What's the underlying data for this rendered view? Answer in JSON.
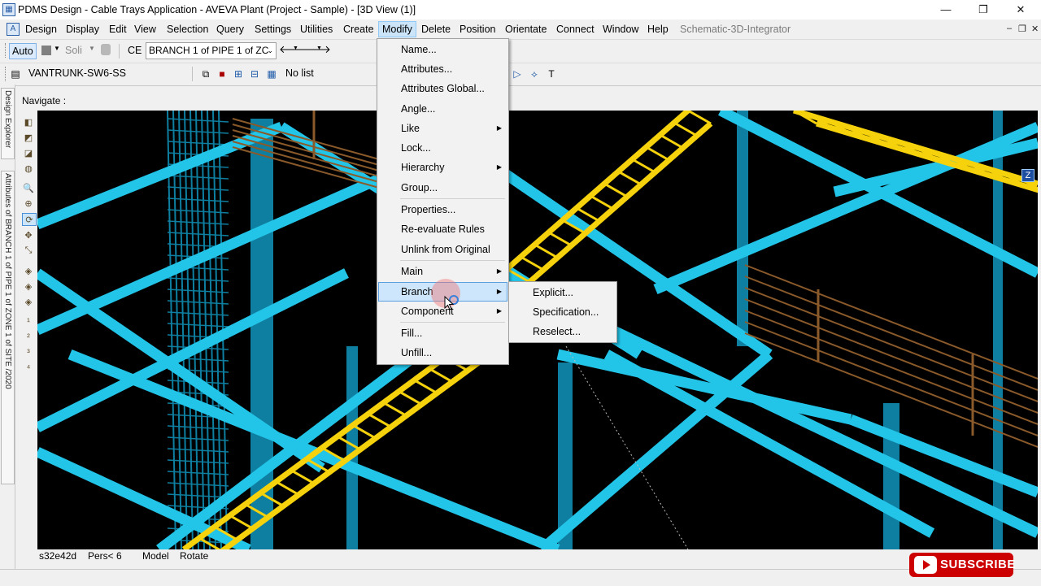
{
  "window": {
    "title": "PDMS Design - Cable Trays Application -  AVEVA Plant (Project - Sample) - [3D View (1)]",
    "controls": {
      "minimize": "—",
      "maximize": "❐",
      "close": "✕"
    }
  },
  "menubar": {
    "items": [
      "Design",
      "Display",
      "Edit",
      "View",
      "Selection",
      "Query",
      "Settings",
      "Utilities",
      "Create",
      "Modify",
      "Delete",
      "Position",
      "Orientate",
      "Connect",
      "Window",
      "Help",
      "Schematic-3D-Integrator"
    ],
    "active": "Modify"
  },
  "toolbar1": {
    "auto_label": "Auto",
    "solid_label": "Soli",
    "ce_label": "CE",
    "ce_value": "BRANCH 1 of PIPE 1 of ZC"
  },
  "toolbar2": {
    "element_value": "VANTRUNK-SW6-SS",
    "list_value": "No list"
  },
  "side_tabs": {
    "design_explorer": "Design Explorer",
    "attributes": "Attributes of BRANCH 1 of PIPE 1 of ZONE 1 of SITE /2020"
  },
  "viewport": {
    "navigate_label": "Navigate :",
    "axis_label": "Z",
    "colors": {
      "steel": "#22c4e8",
      "steel_dark": "#0e7fa0",
      "tray": "#f5d20c",
      "rail": "#8a5a2a",
      "background": "#000000"
    }
  },
  "statusbar": {
    "id": "s32e42d",
    "pers": "Pers< 6",
    "mode": "Model",
    "action": "Rotate"
  },
  "modify_menu": {
    "items": [
      {
        "label": "Name...",
        "submenu": false
      },
      {
        "label": "Attributes...",
        "submenu": false
      },
      {
        "label": "Attributes Global...",
        "submenu": false
      },
      {
        "label": "Angle...",
        "submenu": false
      },
      {
        "label": "Like",
        "submenu": true
      },
      {
        "label": "Lock...",
        "submenu": false
      },
      {
        "label": "Hierarchy",
        "submenu": true
      },
      {
        "label": "Group...",
        "submenu": false
      },
      {
        "label": "Properties...",
        "submenu": false
      },
      {
        "label": "Re-evaluate Rules",
        "submenu": false
      },
      {
        "label": "Unlink from Original",
        "submenu": false
      },
      {
        "label": "Main",
        "submenu": true
      },
      {
        "label": "Branch",
        "submenu": true,
        "highlighted": true
      },
      {
        "label": "Component",
        "submenu": true
      },
      {
        "label": "Fill...",
        "submenu": false
      },
      {
        "label": "Unfill...",
        "submenu": false
      }
    ]
  },
  "branch_submenu": {
    "items": [
      "Explicit...",
      "Specification...",
      "Reselect..."
    ]
  },
  "overlay": {
    "subscribe_label": "SUBSCRIBE"
  }
}
